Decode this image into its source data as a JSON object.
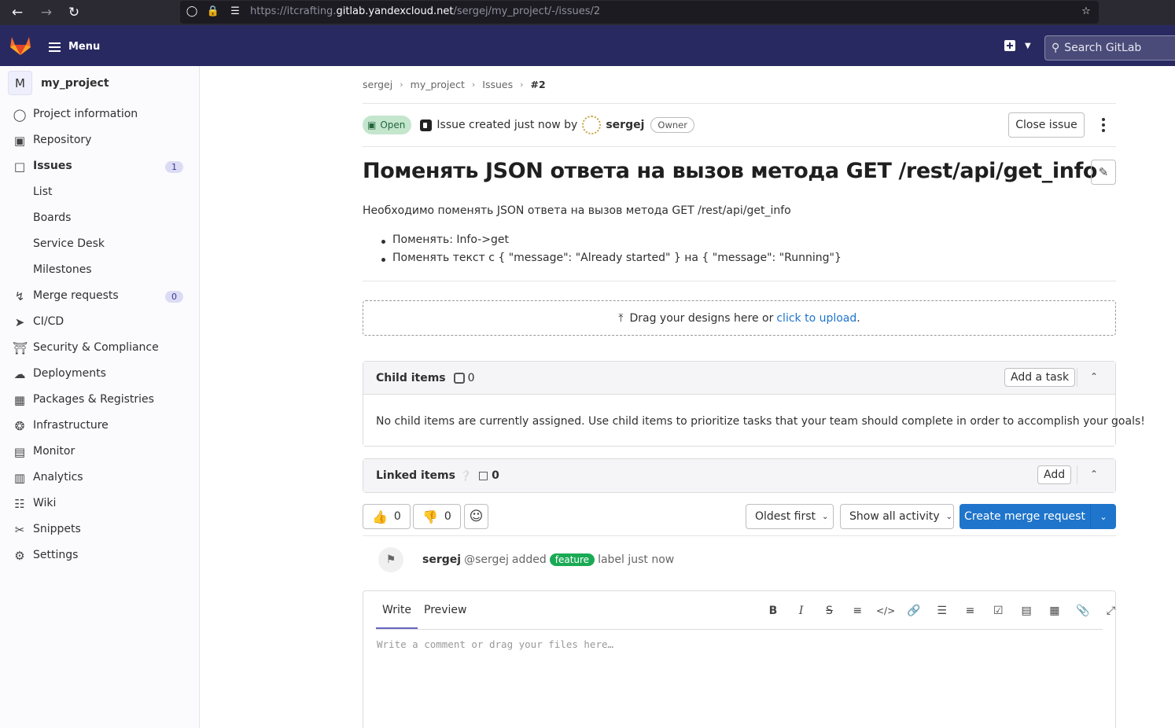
{
  "browser": {
    "url_prefix": "https://itcrafting.",
    "url_host": "gitlab.yandexcloud.net",
    "url_path": "/sergej/my_project/-/issues/2"
  },
  "header": {
    "menu_label": "Menu",
    "search_placeholder": "Search GitLab"
  },
  "sidebar": {
    "project_initial": "M",
    "project_name": "my_project",
    "items": [
      {
        "label": "Project information",
        "icon": "project-info-icon"
      },
      {
        "label": "Repository",
        "icon": "repository-icon"
      },
      {
        "label": "Issues",
        "icon": "issues-icon",
        "badge": "1"
      },
      {
        "label": "List"
      },
      {
        "label": "Boards"
      },
      {
        "label": "Service Desk"
      },
      {
        "label": "Milestones"
      },
      {
        "label": "Merge requests",
        "icon": "merge-request-icon",
        "badge": "0"
      },
      {
        "label": "CI/CD",
        "icon": "rocket-icon"
      },
      {
        "label": "Security & Compliance",
        "icon": "shield-icon"
      },
      {
        "label": "Deployments",
        "icon": "deployments-icon"
      },
      {
        "label": "Packages & Registries",
        "icon": "package-icon"
      },
      {
        "label": "Infrastructure",
        "icon": "infrastructure-icon"
      },
      {
        "label": "Monitor",
        "icon": "monitor-icon"
      },
      {
        "label": "Analytics",
        "icon": "chart-icon"
      },
      {
        "label": "Wiki",
        "icon": "book-icon"
      },
      {
        "label": "Snippets",
        "icon": "scissors-icon"
      },
      {
        "label": "Settings",
        "icon": "settings-icon"
      }
    ]
  },
  "breadcrumb": [
    "sergej",
    "my_project",
    "Issues",
    "#2"
  ],
  "issue": {
    "status": "Open",
    "created_text": "Issue created just now by",
    "author": "sergej",
    "author_role": "Owner",
    "close_label": "Close issue",
    "title": "Поменять JSON ответа на вызов метода GET /rest/api/get_info",
    "description": "Необходимо поменять JSON ответа на вызов метода GET /rest/api/get_info",
    "bullets": [
      "Поменять: Info->get",
      "Поменять текст с { \"message\": \"Already started\" } на { \"message\": \"Running\"}"
    ]
  },
  "designs": {
    "text": "Drag your designs here or",
    "link": "click to upload",
    "end": "."
  },
  "child_items": {
    "title": "Child items",
    "count": "0",
    "add_label": "Add a task",
    "empty_text": "No child items are currently assigned. Use child items to prioritize tasks that your team should complete in order to accomplish your goals!"
  },
  "linked_items": {
    "title": "Linked items",
    "count": "0",
    "add_label": "Add"
  },
  "reactions": {
    "thumbs_up": "👍",
    "thumbs_up_count": "0",
    "thumbs_down": "👎",
    "thumbs_down_count": "0"
  },
  "sort_label": "Oldest first",
  "filter_label": "Show all activity",
  "create_mr_label": "Create merge request",
  "activity": {
    "user": "sergej",
    "handle": "@sergej",
    "action": "added",
    "label": "feature",
    "suffix": "label just now"
  },
  "comment": {
    "tab_write": "Write",
    "tab_preview": "Preview",
    "placeholder": "Write a comment or drag your files here…"
  },
  "colors": {
    "header_bg": "#292961",
    "accent": "#1f75cb",
    "open_badge": "#c3e6cd",
    "label_feature": "#1aaa55"
  }
}
